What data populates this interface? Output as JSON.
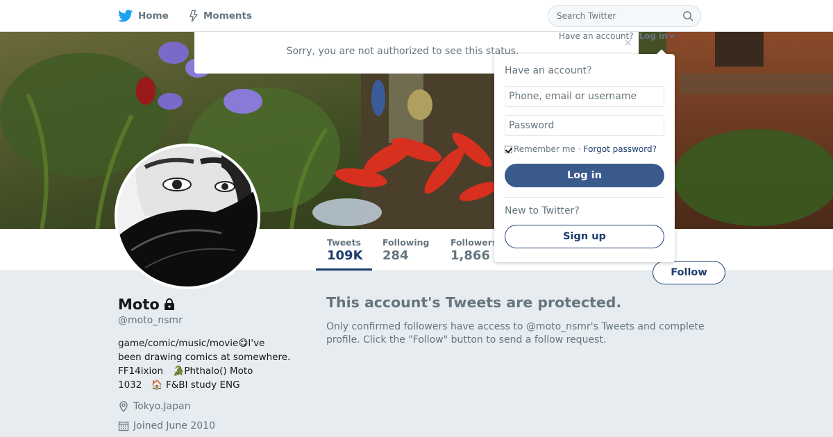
{
  "nav": {
    "home_label": "Home",
    "moments_label": "Moments",
    "search_placeholder": "Search Twitter"
  },
  "account_prompt": {
    "text": "Have an account?",
    "login_label": "Log in"
  },
  "notice": {
    "text": "Sorry, you are not authorized to see this status.",
    "close": "×"
  },
  "stats": [
    {
      "label": "Tweets",
      "value": "109K"
    },
    {
      "label": "Following",
      "value": "284"
    },
    {
      "label": "Followers",
      "value": "1,866"
    }
  ],
  "follow_label": "Follow",
  "profile": {
    "name": "Moto",
    "handle": "@moto_nsmr",
    "bio_lines": [
      "game/comic/music/movie😋I've",
      "been drawing comics at somewhere.",
      "FF14ixion　🐊Phthalo() Moto",
      "1032　🏠 F&BI study ENG"
    ],
    "location": "Tokyo.Japan",
    "joined": "Joined June 2010"
  },
  "protected": {
    "title": "This account's Tweets are protected.",
    "body": "Only confirmed followers have access to @moto_nsmr's Tweets and complete profile. Click the \"Follow\" button to send a follow request."
  },
  "login_dropdown": {
    "heading": "Have an account?",
    "username_placeholder": "Phone, email or username",
    "password_placeholder": "Password",
    "remember_label": "Remember me",
    "separator": "·",
    "forgot_label": "Forgot password?",
    "login_button": "Log in",
    "new_heading": "New to Twitter?",
    "signup_button": "Sign up"
  },
  "colors": {
    "accent": "#1c3d6e",
    "login_button": "#3b5a8c",
    "twitter_blue": "#1da1f2",
    "muted_text": "#66757f",
    "page_background": "#e6ecf0"
  },
  "icons": [
    "twitter-bird-icon",
    "lightning-icon",
    "search-icon",
    "lock-icon",
    "location-pin-icon",
    "calendar-icon",
    "caret-down-icon",
    "close-icon"
  ]
}
